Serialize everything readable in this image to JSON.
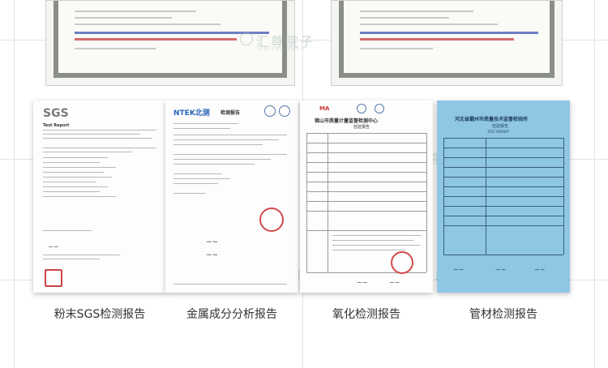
{
  "reports": [
    {
      "id": "sgs",
      "caption": "粉末SGS检测报告",
      "logo": "SGS",
      "title": "Test Report"
    },
    {
      "id": "ntek",
      "caption": "金属成分分析报告",
      "logo": "NTEK北测",
      "title": "检测报告"
    },
    {
      "id": "foshan",
      "caption": "氧化检测报告",
      "logo": "MA",
      "title": "佛山市质量计量监督检测中心",
      "subtitle": "检验报告"
    },
    {
      "id": "hebei",
      "caption": "管材检测报告",
      "title": "河北省霸州市质量技术监督检验所",
      "subtitle": "检验报告",
      "en_title": "TEST REPORT"
    }
  ],
  "watermark": {
    "text": "汇尊院子",
    "sub": "HUIZUN YARD"
  },
  "colors": {
    "caption": "#333333",
    "blue_report": "#8fc6e4",
    "stamp_red": "#d24a4a",
    "frame_grey": "#8a8f86"
  }
}
